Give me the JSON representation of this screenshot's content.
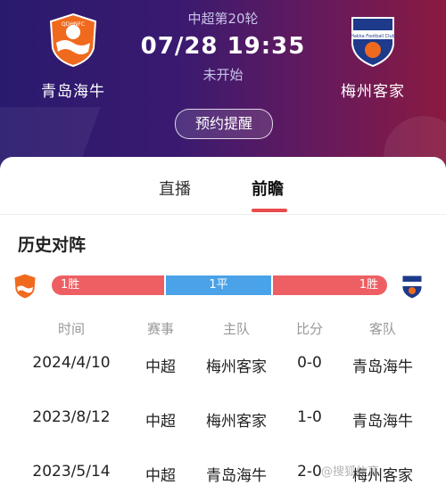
{
  "match": {
    "league": "中超第20轮",
    "time": "07/28 19:35",
    "status": "未开始",
    "remind_label": "预约提醒"
  },
  "home": {
    "name": "青岛海牛",
    "badge_text": "QDHNFC"
  },
  "away": {
    "name": "梅州客家",
    "badge_text": "Hakka Football Club"
  },
  "tabs": [
    {
      "label": "直播"
    },
    {
      "label": "前瞻"
    }
  ],
  "history": {
    "title": "历史对阵",
    "home_wins": "1胜",
    "draws": "1平",
    "away_wins": "1胜",
    "columns": [
      "时间",
      "赛事",
      "主队",
      "比分",
      "客队"
    ],
    "rows": [
      {
        "date": "2024/4/10",
        "comp": "中超",
        "home": "梅州客家",
        "score": "0-0",
        "away": "青岛海牛"
      },
      {
        "date": "2023/8/12",
        "comp": "中超",
        "home": "梅州客家",
        "score": "1-0",
        "away": "青岛海牛"
      },
      {
        "date": "2023/5/14",
        "comp": "中超",
        "home": "青岛海牛",
        "score": "2-0",
        "away": "梅州客家"
      }
    ]
  },
  "watermark": "@搜狐体育",
  "colors": {
    "accent": "#e94b4b",
    "win": "#ee5f63",
    "draw": "#4aa3e8"
  }
}
